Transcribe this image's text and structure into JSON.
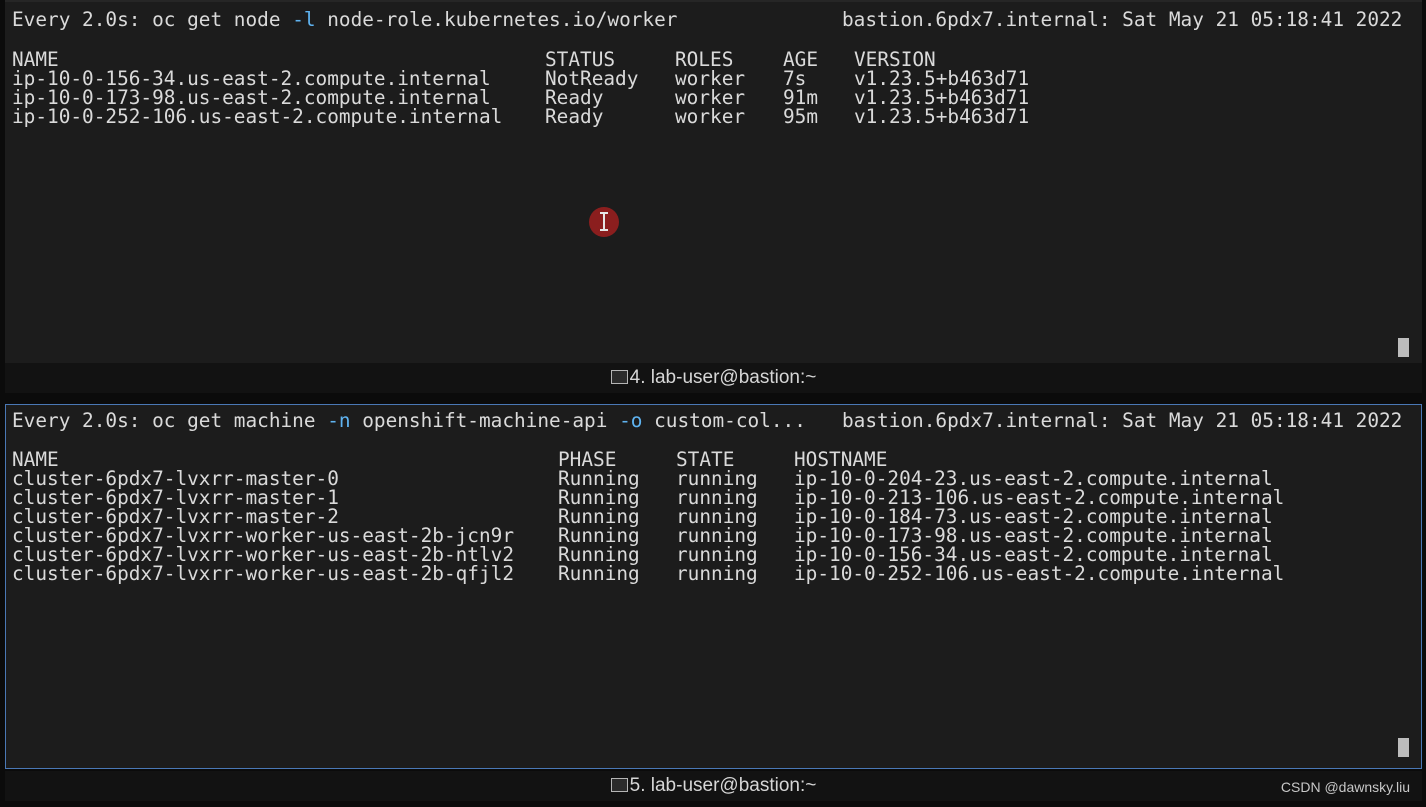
{
  "top_pane": {
    "header_prefix": "Every 2.0s: oc get node ",
    "header_flag": "-l",
    "header_rest": " node-role.kubernetes.io/worker",
    "header_right": "bastion.6pdx7.internal: Sat May 21 05:18:41 2022",
    "columns": [
      "NAME",
      "STATUS",
      "ROLES",
      "AGE",
      "VERSION"
    ],
    "rows": [
      [
        "ip-10-0-156-34.us-east-2.compute.internal",
        "NotReady",
        "worker",
        "7s",
        "v1.23.5+b463d71"
      ],
      [
        "ip-10-0-173-98.us-east-2.compute.internal",
        "Ready",
        "worker",
        "91m",
        "v1.23.5+b463d71"
      ],
      [
        "ip-10-0-252-106.us-east-2.compute.internal",
        "Ready",
        "worker",
        "95m",
        "v1.23.5+b463d71"
      ]
    ],
    "tab_title": "4. lab-user@bastion:~"
  },
  "bottom_pane": {
    "header_prefix": "Every 2.0s: oc get machine ",
    "header_flag1": "-n",
    "header_mid": " openshift-machine-api ",
    "header_flag2": "-o",
    "header_rest": " custom-col...",
    "header_right": "bastion.6pdx7.internal: Sat May 21 05:18:41 2022",
    "columns": [
      "NAME",
      "PHASE",
      "STATE",
      "HOSTNAME"
    ],
    "rows": [
      [
        "cluster-6pdx7-lvxrr-master-0",
        "Running",
        "running",
        "ip-10-0-204-23.us-east-2.compute.internal"
      ],
      [
        "cluster-6pdx7-lvxrr-master-1",
        "Running",
        "running",
        "ip-10-0-213-106.us-east-2.compute.internal"
      ],
      [
        "cluster-6pdx7-lvxrr-master-2",
        "Running",
        "running",
        "ip-10-0-184-73.us-east-2.compute.internal"
      ],
      [
        "cluster-6pdx7-lvxrr-worker-us-east-2b-jcn9r",
        "Running",
        "running",
        "ip-10-0-173-98.us-east-2.compute.internal"
      ],
      [
        "cluster-6pdx7-lvxrr-worker-us-east-2b-ntlv2",
        "Running",
        "running",
        "ip-10-0-156-34.us-east-2.compute.internal"
      ],
      [
        "cluster-6pdx7-lvxrr-worker-us-east-2b-qfjl2",
        "Running",
        "running",
        "ip-10-0-252-106.us-east-2.compute.internal"
      ]
    ],
    "tab_title": "5. lab-user@bastion:~"
  },
  "watermark": "CSDN @dawnsky.liu",
  "colors": {
    "flag": "#5fb3f0",
    "text": "#dadada",
    "background": "#1c1c1c",
    "active_border": "#4a78b5"
  },
  "icons": {
    "tab": "terminal-icon",
    "pointer": "text-cursor-icon"
  }
}
